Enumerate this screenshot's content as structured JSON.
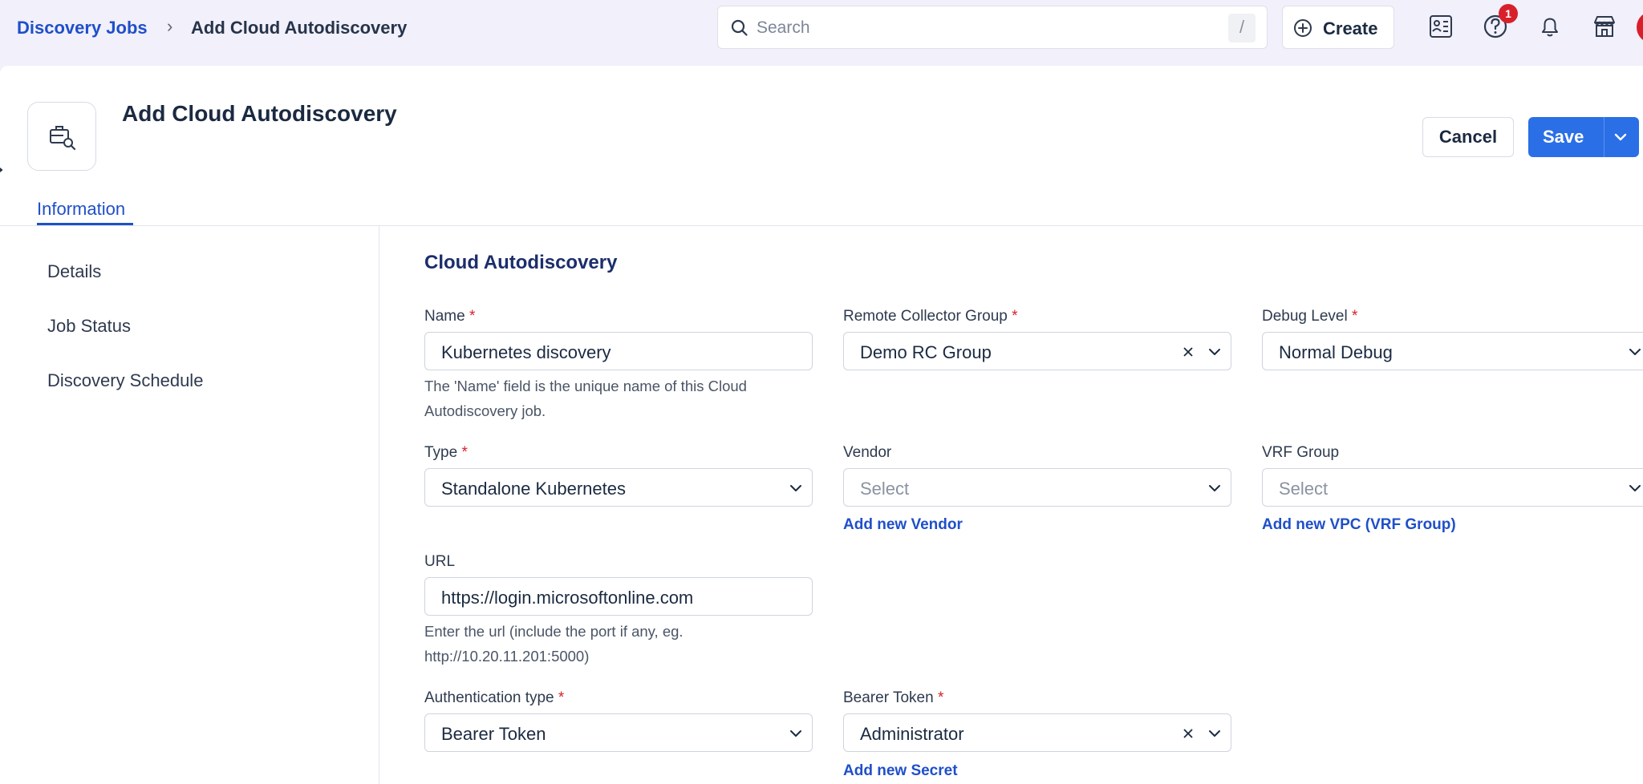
{
  "breadcrumb": {
    "parent": "Discovery Jobs",
    "separator": "›",
    "current": "Add Cloud Autodiscovery"
  },
  "search": {
    "placeholder": "Search",
    "shortcut": "/"
  },
  "create_button": {
    "label": "Create"
  },
  "top_icons": [
    "contacts-list-icon",
    "help-icon",
    "bell-icon",
    "store-icon"
  ],
  "help_badge": "1",
  "page": {
    "title": "Add Cloud Autodiscovery",
    "icon": "briefcase-search-icon"
  },
  "actions": {
    "cancel": "Cancel",
    "save": "Save"
  },
  "tabs": [
    {
      "label": "Information",
      "active": true
    }
  ],
  "sidebar": {
    "items": [
      {
        "label": "Details"
      },
      {
        "label": "Job Status"
      },
      {
        "label": "Discovery Schedule"
      }
    ]
  },
  "form": {
    "section_title": "Cloud Autodiscovery",
    "required_mark": "*",
    "name": {
      "label": "Name",
      "value": "Kubernetes discovery",
      "help": "The 'Name' field is the unique name of this Cloud Autodiscovery job."
    },
    "remote_collector_group": {
      "label": "Remote Collector Group",
      "value": "Demo RC Group"
    },
    "debug_level": {
      "label": "Debug Level",
      "value": "Normal Debug"
    },
    "type": {
      "label": "Type",
      "value": "Standalone Kubernetes"
    },
    "vendor": {
      "label": "Vendor",
      "placeholder": "Select",
      "add_link": "Add new Vendor"
    },
    "vrf_group": {
      "label": "VRF Group",
      "placeholder": "Select",
      "add_link": "Add new VPC (VRF Group)"
    },
    "url": {
      "label": "URL",
      "value": "https://login.microsoftonline.com",
      "help": "Enter the url (include the port if any, eg. http://10.20.11.201:5000)"
    },
    "auth_type": {
      "label": "Authentication type",
      "value": "Bearer Token"
    },
    "bearer_token": {
      "label": "Bearer Token",
      "value": "Administrator",
      "add_link": "Add new Secret"
    }
  },
  "colors": {
    "accent": "#1f4fc9",
    "primary_button": "#2b6fe6",
    "required": "#d8202b",
    "page_bg": "#f1f0fb"
  }
}
